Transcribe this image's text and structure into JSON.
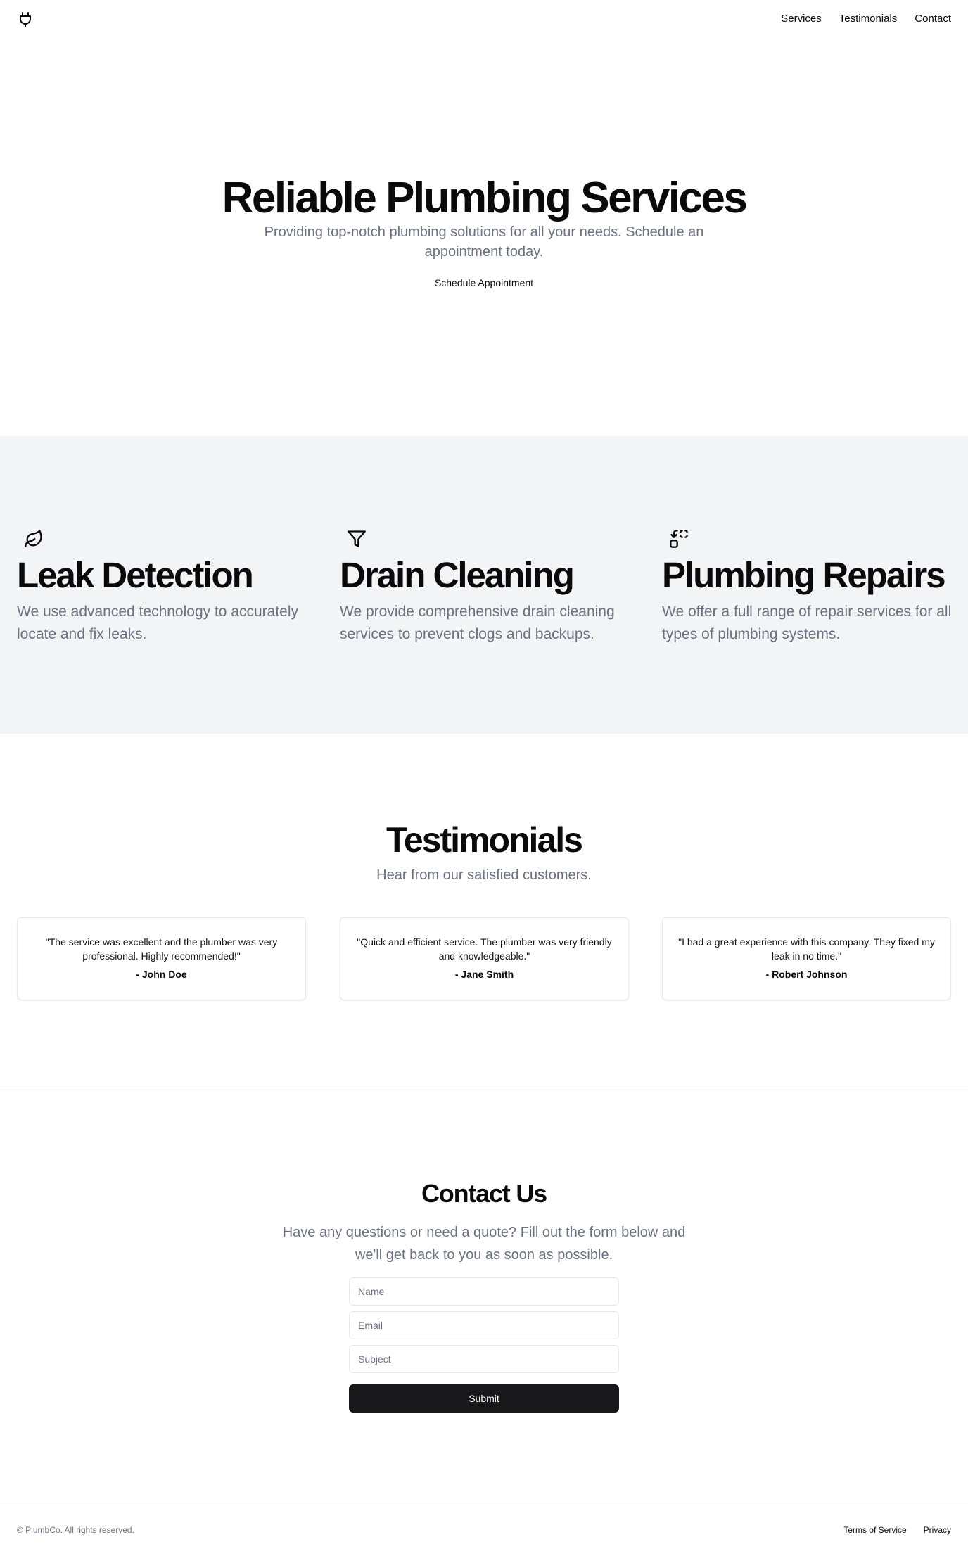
{
  "header": {
    "logo_icon": "plug-icon",
    "nav": [
      {
        "label": "Services"
      },
      {
        "label": "Testimonials"
      },
      {
        "label": "Contact"
      }
    ]
  },
  "hero": {
    "title": "Reliable Plumbing Services",
    "subtitle": "Providing top-notch plumbing solutions for all your needs. Schedule an appointment today.",
    "cta_label": "Schedule Appointment"
  },
  "services": {
    "items": [
      {
        "icon": "leaf-icon",
        "title": "Leak Detection",
        "description": "We use advanced technology to accurately locate and fix leaks."
      },
      {
        "icon": "filter-icon",
        "title": "Drain Cleaning",
        "description": "We provide comprehensive drain cleaning services to prevent clogs and backups."
      },
      {
        "icon": "replace-icon",
        "title": "Plumbing Repairs",
        "description": "We offer a full range of repair services for all types of plumbing systems."
      }
    ]
  },
  "testimonials": {
    "title": "Testimonials",
    "subtitle": "Hear from our satisfied customers.",
    "items": [
      {
        "quote": "\"The service was excellent and the plumber was very professional. Highly recommended!\"",
        "author": "- John Doe"
      },
      {
        "quote": "\"Quick and efficient service. The plumber was very friendly and knowledgeable.\"",
        "author": "- Jane Smith"
      },
      {
        "quote": "\"I had a great experience with this company. They fixed my leak in no time.\"",
        "author": "- Robert Johnson"
      }
    ]
  },
  "contact": {
    "title": "Contact Us",
    "subtitle": "Have any questions or need a quote? Fill out the form below and we'll get back to you as soon as possible.",
    "fields": {
      "name_placeholder": "Name",
      "email_placeholder": "Email",
      "subject_placeholder": "Subject"
    },
    "submit_label": "Submit"
  },
  "footer": {
    "copyright": "© PlumbCo. All rights reserved.",
    "links": [
      {
        "label": "Terms of Service"
      },
      {
        "label": "Privacy"
      }
    ]
  },
  "colors": {
    "muted_text": "#6b7280",
    "section_bg": "#f3f4f6",
    "button_dark": "#18181b",
    "border": "#e5e7eb"
  }
}
